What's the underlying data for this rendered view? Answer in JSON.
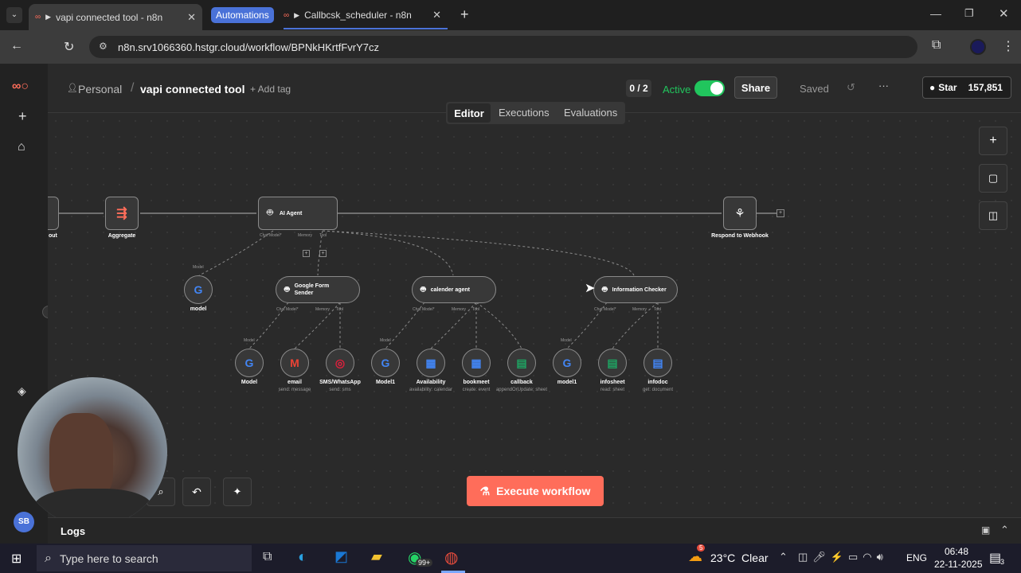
{
  "browser": {
    "tabs": [
      {
        "label": "vapi connected tool - n8n"
      },
      {
        "label": "Automations"
      },
      {
        "label": "Callbcsk_scheduler - n8n"
      }
    ],
    "url": "n8n.srv1066360.hstgr.cloud/workflow/BPNkHKrtfFvrY7cz"
  },
  "header": {
    "project": "Personal",
    "workflow_name": "vapi connected tool",
    "add_tag": "+ Add tag",
    "counter": "0 / 2",
    "active_label": "Active",
    "share": "Share",
    "saved": "Saved",
    "star": "Star",
    "star_count": "157,851"
  },
  "view_tabs": {
    "editor": "Editor",
    "executions": "Executions",
    "evaluations": "Evaluations"
  },
  "nodes": {
    "aggregate": "Aggregate",
    "ai_agent": "AI Agent",
    "respond": "Respond to Webhook",
    "model_top": "model",
    "model_top_port": "Model",
    "google_form_sender": "Google Form Sender",
    "calender_agent": "calender agent",
    "information_checker": "Information Checker",
    "ai_agent_ports": {
      "chat_model": "Chat Model*",
      "memory": "Memory",
      "tool": "Tool"
    },
    "subagent_ports": {
      "chat_model": "Chat Model*",
      "memory": "Memory",
      "tool": "Tool"
    },
    "tools": [
      {
        "label": "Model",
        "sub": "",
        "port": "Model"
      },
      {
        "label": "email",
        "sub": "send: message"
      },
      {
        "label": "SMS/WhatsApp",
        "sub": "send: sms"
      },
      {
        "label": "Model1",
        "sub": "",
        "port": "Model"
      },
      {
        "label": "Availability",
        "sub": "availability: calendar"
      },
      {
        "label": "bookmeet",
        "sub": "create: event"
      },
      {
        "label": "callback",
        "sub": "appendOrUpdate: sheet"
      },
      {
        "label": "model1",
        "sub": "",
        "port": "Model"
      },
      {
        "label": "infosheet",
        "sub": "read: sheet"
      },
      {
        "label": "infodoc",
        "sub": "get: document"
      }
    ],
    "left_cut": "out"
  },
  "execute": "Execute workflow",
  "logs": "Logs",
  "avatar_initials": "SB",
  "taskbar": {
    "search": "Type here to search",
    "weather": "23°C  Clear",
    "lang": "ENG",
    "time": "06:48",
    "date": "22-11-2025",
    "weather_badge": "5",
    "notif": "3",
    "whatsapp_badge": "99+"
  },
  "colors": {
    "accent": "#ff6d5a",
    "active": "#21c55d",
    "tab_active": "#4a72d8"
  }
}
